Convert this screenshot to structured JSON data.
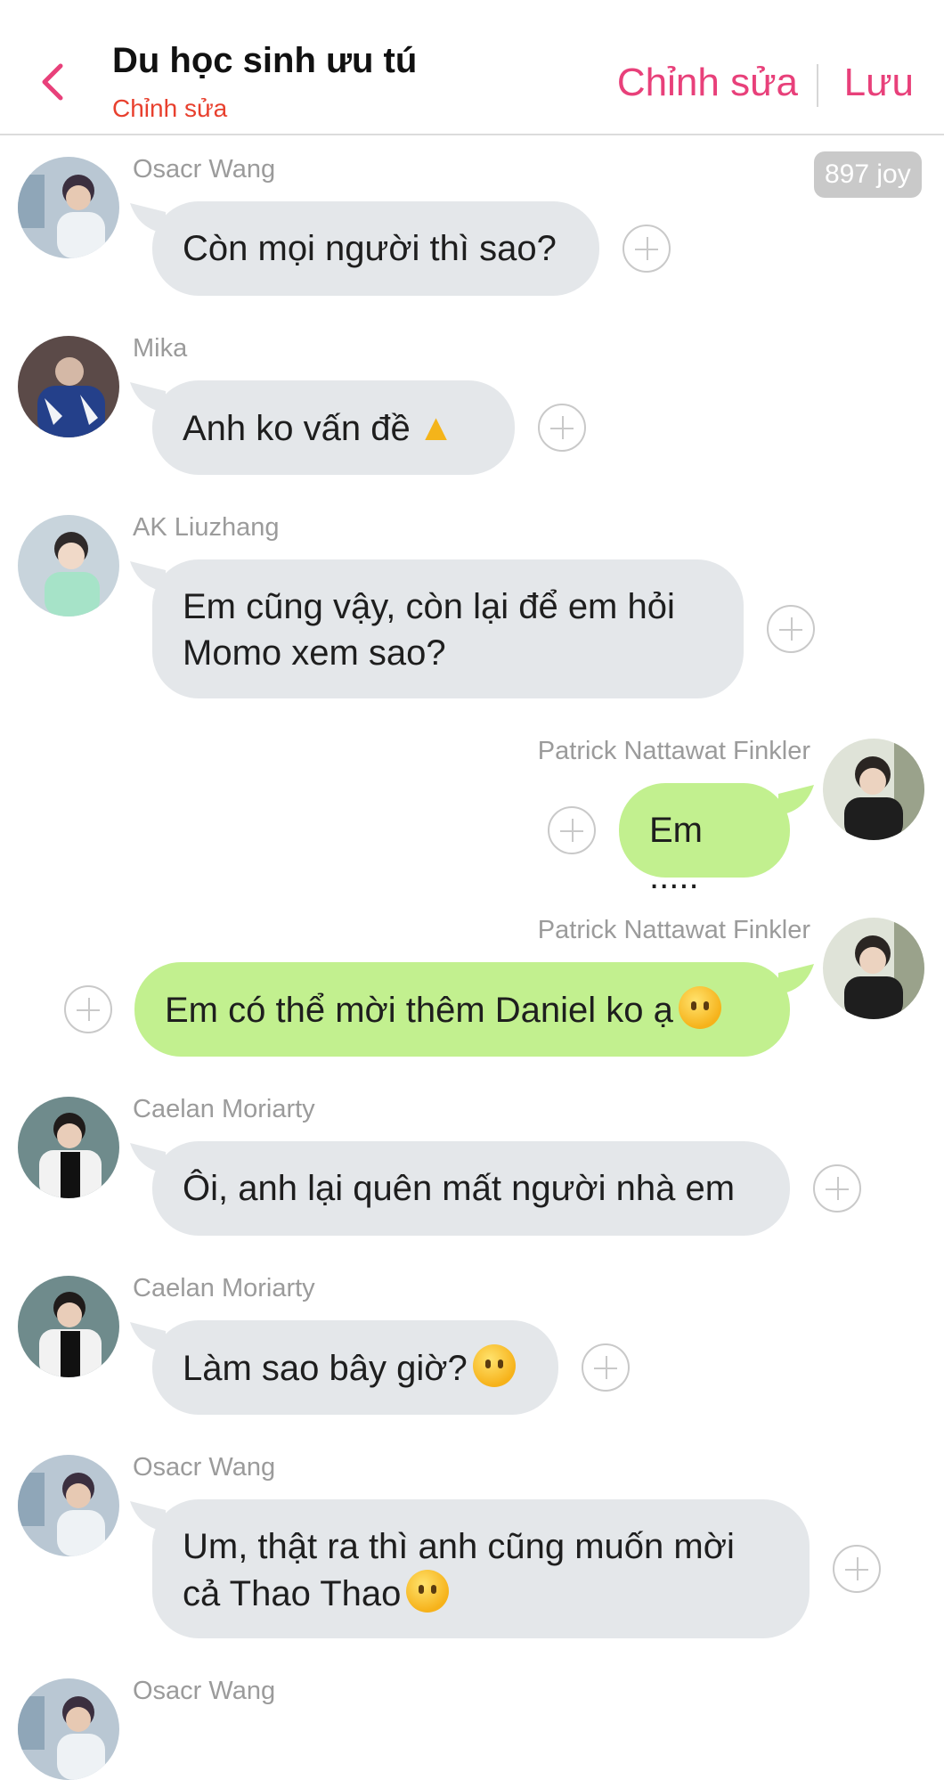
{
  "header": {
    "title": "Du học sinh ưu tú",
    "subtitle": "Chỉnh sửa",
    "edit_label": "Chỉnh sửa",
    "save_label": "Lưu",
    "accent": "#e8407a",
    "subtitle_color": "#e8402e"
  },
  "badge": {
    "joy": "897 joy"
  },
  "messages": [
    {
      "sender": "Osacr Wang",
      "text": "Còn mọi người thì sao?",
      "side": "left"
    },
    {
      "sender": "Mika",
      "text": "Anh ko vấn đề",
      "emoji": "thumbs-up-emoji",
      "side": "left"
    },
    {
      "sender": "AK Liuzhang",
      "line1": "Em cũng vậy, còn lại để em hỏi",
      "line2": "Momo xem sao?",
      "side": "left"
    },
    {
      "sender": "Patrick Nattawat Finkler",
      "text": "Em .....",
      "side": "right"
    },
    {
      "sender": "Patrick Nattawat Finkler",
      "text": "Em có thể mời thêm Daniel ko ạ",
      "emoji": "no-mouth-face-emoji",
      "side": "right"
    },
    {
      "sender": "Caelan Moriarty",
      "text": "Ôi, anh lại quên mất người nhà em",
      "side": "left"
    },
    {
      "sender": "Caelan Moriarty",
      "text": "Làm sao bây giờ?",
      "emoji": "crying-face-emoji",
      "side": "left"
    },
    {
      "sender": "Osacr Wang",
      "line1": "Um, thật ra thì anh cũng muốn mời",
      "line2": "cả Thao Thao",
      "emoji": "slight-smile-emoji",
      "side": "left"
    },
    {
      "sender": "Osacr Wang",
      "side": "left"
    }
  ],
  "colors": {
    "bubble_left": "#e4e7ea",
    "bubble_right": "#c2f08f",
    "name_gray": "#9b9b9b"
  }
}
